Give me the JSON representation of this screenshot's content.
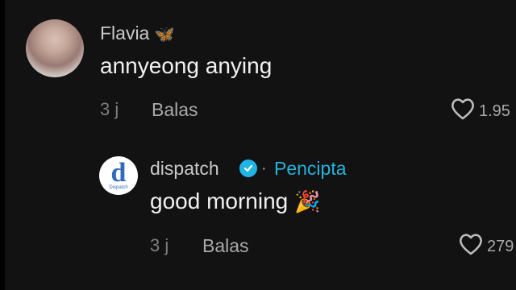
{
  "comments": [
    {
      "user": "Flavia",
      "emoji": "🦋",
      "text": "annyeong anying",
      "time": "3 j",
      "reply_label": "Balas",
      "likes": "1.95"
    },
    {
      "user": "dispatch",
      "role": "Pencipta",
      "separator": "·",
      "text": "good morning",
      "emoji": "🎉",
      "time": "3 j",
      "reply_label": "Balas",
      "likes": "279",
      "avatar_letter": "d",
      "avatar_subtext": "Dispatch"
    }
  ],
  "colors": {
    "background": "#121212",
    "creator_badge": "#25b3dc",
    "verified": "#21b4e8"
  }
}
